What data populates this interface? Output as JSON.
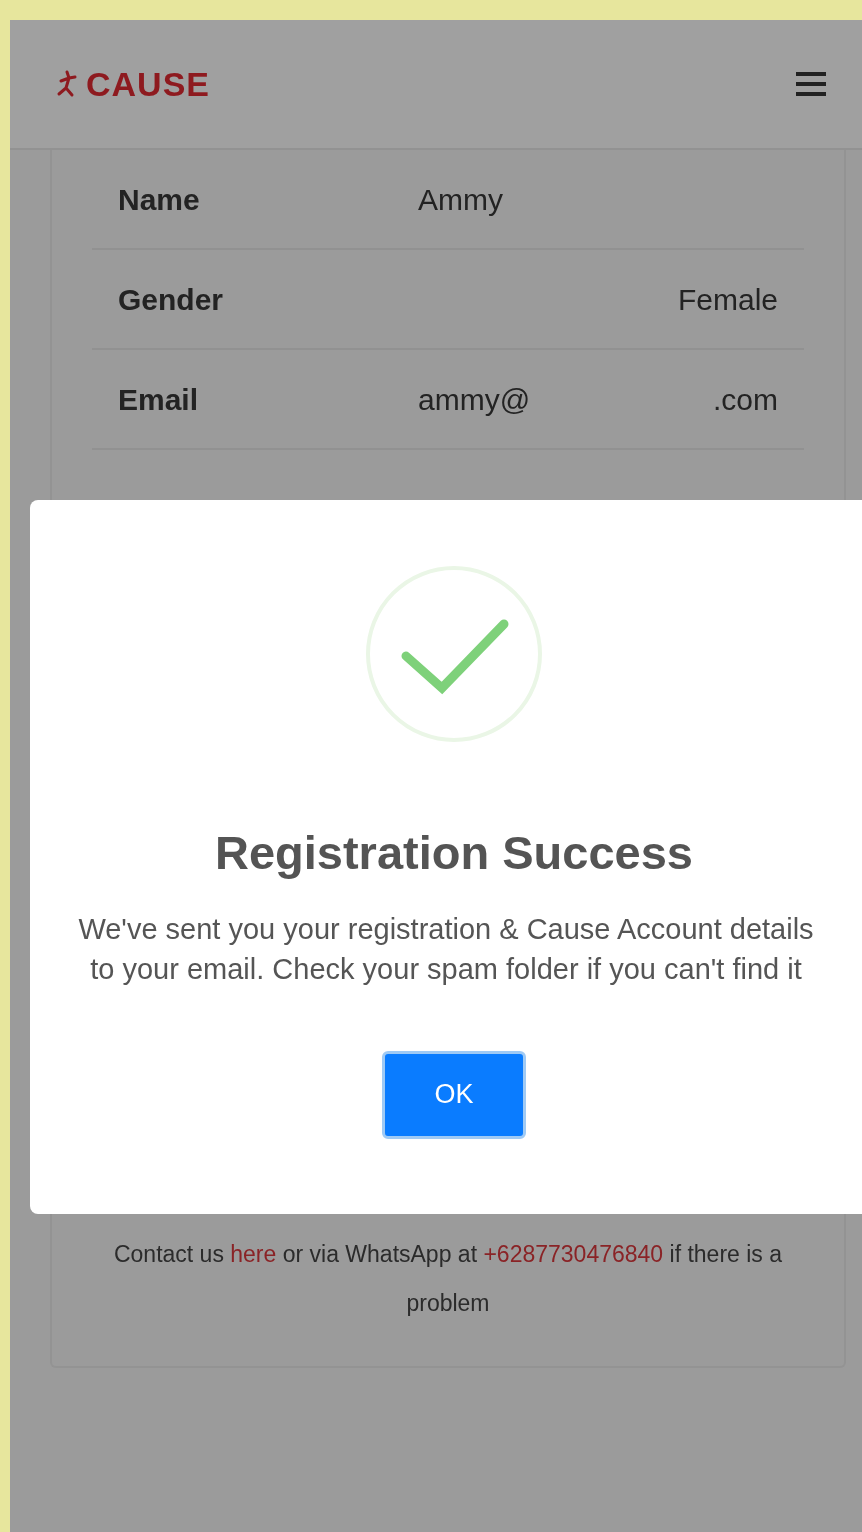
{
  "header": {
    "logo": "CAUSE"
  },
  "details": [
    {
      "label": "Name",
      "values": [
        "Ammy"
      ]
    },
    {
      "label": "Gender",
      "values": [
        "Female"
      ]
    },
    {
      "label": "Email",
      "values": [
        "ammy@",
        ".com"
      ]
    }
  ],
  "contact": {
    "before": "Contact us ",
    "link": "here",
    "middle": " or via WhatsApp at ",
    "phone": "+6287730476840",
    "after": " if there is a problem"
  },
  "modal": {
    "title": "Registration Success",
    "message": "We've sent you your registration & Cause Account details to your email. Check your spam folder if you can't find it",
    "button": "OK"
  }
}
